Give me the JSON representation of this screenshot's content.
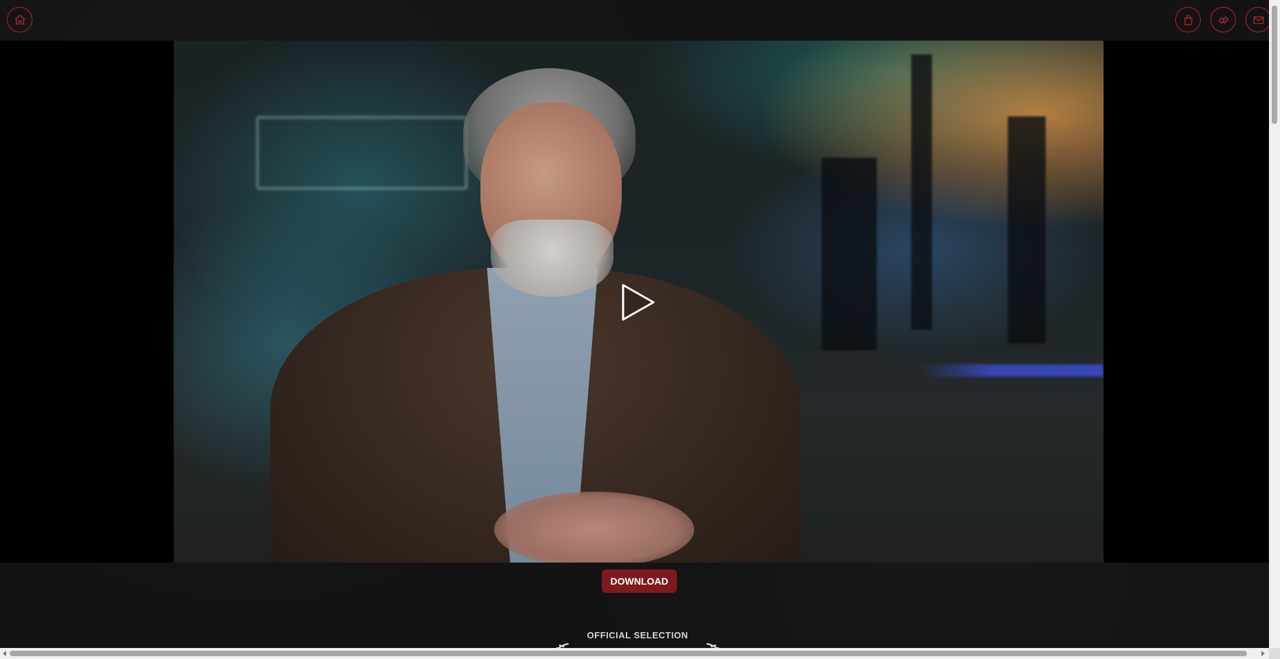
{
  "header": {
    "home_label": "Home",
    "cart_label": "Shop",
    "handshake_label": "Partners",
    "mail_label": "Contact"
  },
  "video": {
    "play_label": "Play video"
  },
  "download": {
    "label": "DOWNLOAD"
  },
  "laurel": {
    "text": "OFFICIAL SELECTION"
  },
  "colors": {
    "accent": "#b3262c",
    "button": "#7d1a1e",
    "background": "#131313"
  }
}
